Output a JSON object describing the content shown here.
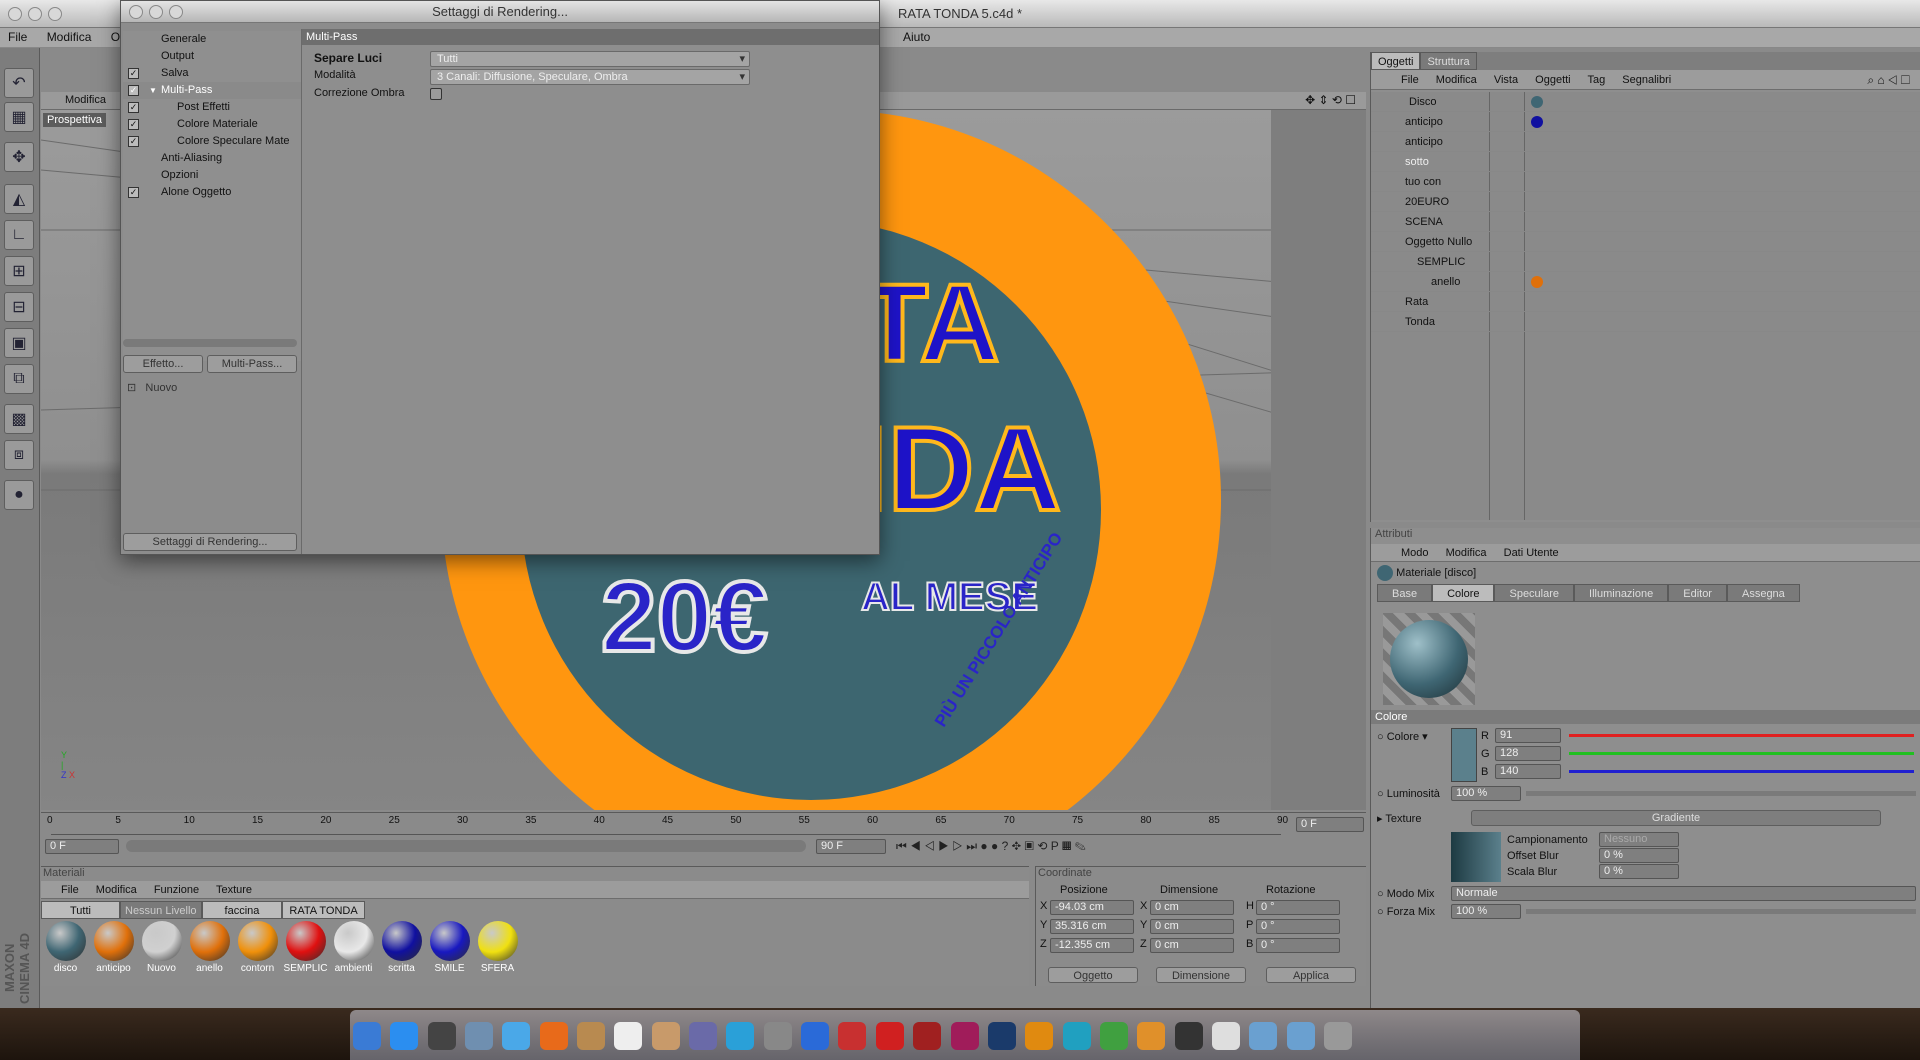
{
  "app": {
    "window_title": "RATA TONDA 5.c4d *",
    "menu": [
      "File",
      "Modifica",
      "Ogg",
      "Aiuto"
    ]
  },
  "viewport": {
    "tab_label": "Modifica",
    "camera_label": "Prospettiva"
  },
  "artwork": {
    "line1": "TA",
    "line2": "NDA",
    "price": "20€",
    "al_mese": "AL MESE",
    "arc_text": "PIÙ UN PICCOLO ANTICIPO"
  },
  "render_dialog": {
    "title": "Settaggi di Rendering...",
    "nav": [
      {
        "label": "Generale",
        "checked": false,
        "indent": 1
      },
      {
        "label": "Output",
        "checked": false,
        "indent": 1
      },
      {
        "label": "Salva",
        "checked": true,
        "indent": 1
      },
      {
        "label": "Multi-Pass",
        "checked": true,
        "indent": 1
      },
      {
        "label": "Post Effetti",
        "checked": true,
        "indent": 2
      },
      {
        "label": "Colore Materiale",
        "checked": true,
        "indent": 2
      },
      {
        "label": "Colore Speculare Mate",
        "checked": true,
        "indent": 2
      },
      {
        "label": "Anti-Aliasing",
        "checked": false,
        "indent": 1
      },
      {
        "label": "Opzioni",
        "checked": false,
        "indent": 1
      },
      {
        "label": "Alone Oggetto",
        "checked": true,
        "indent": 1
      }
    ],
    "effect_button": "Effetto...",
    "multipass_button": "Multi-Pass...",
    "nuovo_label": "Nuovo",
    "footer_button": "Settaggi di Rendering...",
    "section_title": "Multi-Pass",
    "separe_luci_label": "Separe Luci",
    "separe_luci_value": "Tutti",
    "modalita_label": "Modalità",
    "modalita_value": "3 Canali: Diffusione, Speculare, Ombra",
    "correzione_label": "Correzione Ombra"
  },
  "objects_panel": {
    "tabs": [
      "Oggetti",
      "Struttura"
    ],
    "menu": [
      "File",
      "Modifica",
      "Vista",
      "Oggetti",
      "Tag",
      "Segnalibri"
    ],
    "items": [
      "Disco",
      "anticipo",
      "anticipo",
      "sotto",
      "tuo con",
      "20EURO",
      "SCENA",
      "Oggetto Nullo",
      "SEMPLIC",
      "anello",
      "Rata",
      "Tonda"
    ]
  },
  "attributes": {
    "header": "Attributi",
    "menu": [
      "Modo",
      "Modifica",
      "Dati Utente"
    ],
    "material_name": "Materiale [disco]",
    "tabs": [
      "Base",
      "Colore",
      "Speculare",
      "Illuminazione",
      "Editor",
      "Assegna"
    ],
    "active_tab": "Colore",
    "section": "Colore",
    "colore_label": "Colore",
    "r_label": "R",
    "r_value": "91",
    "g_label": "G",
    "g_value": "128",
    "b_label": "B",
    "b_value": "140",
    "swatch_color": "#5b808c",
    "luminosita_label": "Luminosità",
    "luminosita_value": "100 %",
    "texture_label": "Texture",
    "gradient_label": "Gradiente",
    "campionamento_label": "Campionamento",
    "campionamento_value": "Nessuno",
    "offset_blur_label": "Offset Blur",
    "offset_blur_value": "0 %",
    "scala_blur_label": "Scala Blur",
    "scala_blur_value": "0 %",
    "modo_mix_label": "Modo Mix",
    "modo_mix_value": "Normale",
    "forza_mix_label": "Forza Mix",
    "forza_mix_value": "100 %"
  },
  "timeline": {
    "ticks": [
      "0",
      "5",
      "10",
      "15",
      "20",
      "25",
      "30",
      "35",
      "40",
      "45",
      "50",
      "55",
      "60",
      "65",
      "70",
      "75",
      "80",
      "85",
      "90"
    ],
    "current_frame": "0 F",
    "start_frame": "0 F",
    "end_frame": "90 F",
    "end_frame2": "90 F"
  },
  "materials": {
    "header": "Materiali",
    "menu": [
      "File",
      "Modifica",
      "Funzione",
      "Texture"
    ],
    "filters": [
      "Tutti",
      "Nessun Livello",
      "faccina",
      "RATA TONDA"
    ],
    "items": [
      {
        "name": "disco",
        "color": "#3f6673"
      },
      {
        "name": "anticipo",
        "color": "#e0700a"
      },
      {
        "name": "Nuovo",
        "color": "#d0d0d0"
      },
      {
        "name": "anello",
        "color": "#e0700a"
      },
      {
        "name": "contorn",
        "color": "#f0900a"
      },
      {
        "name": "SEMPLIC",
        "color": "#e01010"
      },
      {
        "name": "ambienti",
        "color": "#e8e8e8"
      },
      {
        "name": "scritta",
        "color": "#1010a0"
      },
      {
        "name": "SMILE",
        "color": "#1818c0"
      },
      {
        "name": "SFERA",
        "color": "#f0e010"
      }
    ]
  },
  "coordinates": {
    "header": "Coordinate",
    "col_pos": "Posizione",
    "col_dim": "Dimensione",
    "col_rot": "Rotazione",
    "rows": [
      {
        "axis": "X",
        "pos": "-94.03 cm",
        "daxis": "X",
        "dim": "0 cm",
        "raxis": "H",
        "rot": "0 °"
      },
      {
        "axis": "Y",
        "pos": "35.316 cm",
        "daxis": "Y",
        "dim": "0 cm",
        "raxis": "P",
        "rot": "0 °"
      },
      {
        "axis": "Z",
        "pos": "-12.355 cm",
        "daxis": "Z",
        "dim": "0 cm",
        "raxis": "B",
        "rot": "0 °"
      }
    ],
    "mode_select": "Oggetto",
    "dim_select": "Dimensione",
    "apply_button": "Applica"
  },
  "brand": "MAXON CINEMA 4D"
}
